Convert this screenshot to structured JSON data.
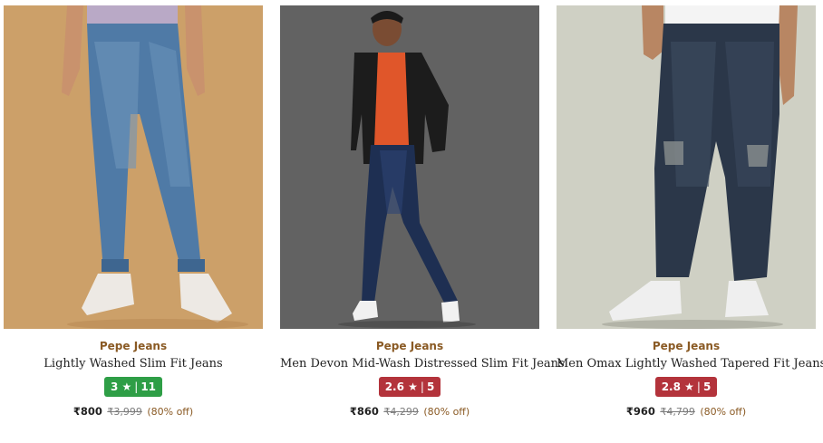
{
  "products": [
    {
      "brand": "Pepe Jeans",
      "title": "Lightly Washed Slim Fit Jeans",
      "rating": "3",
      "reviews": "11",
      "rating_color": "#2e9e46",
      "price": "₹800",
      "mrp": "₹3,999",
      "discount": "(80% off)",
      "image_alt": "jeans-model-photo"
    },
    {
      "brand": "Pepe Jeans",
      "title": "Men Devon Mid-Wash Distressed Slim Fit Jeans",
      "rating": "2.6",
      "reviews": "5",
      "rating_color": "#b3333b",
      "price": "₹860",
      "mrp": "₹4,299",
      "discount": "(80% off)",
      "image_alt": "jeans-model-photo"
    },
    {
      "brand": "Pepe Jeans",
      "title": "Men Omax Lightly Washed Tapered Fit Jeans",
      "rating": "2.8",
      "reviews": "5",
      "rating_color": "#b3333b",
      "price": "₹960",
      "mrp": "₹4,799",
      "discount": "(80% off)",
      "image_alt": "jeans-model-photo"
    }
  ],
  "star_glyph": "★",
  "rating_separator": "|"
}
